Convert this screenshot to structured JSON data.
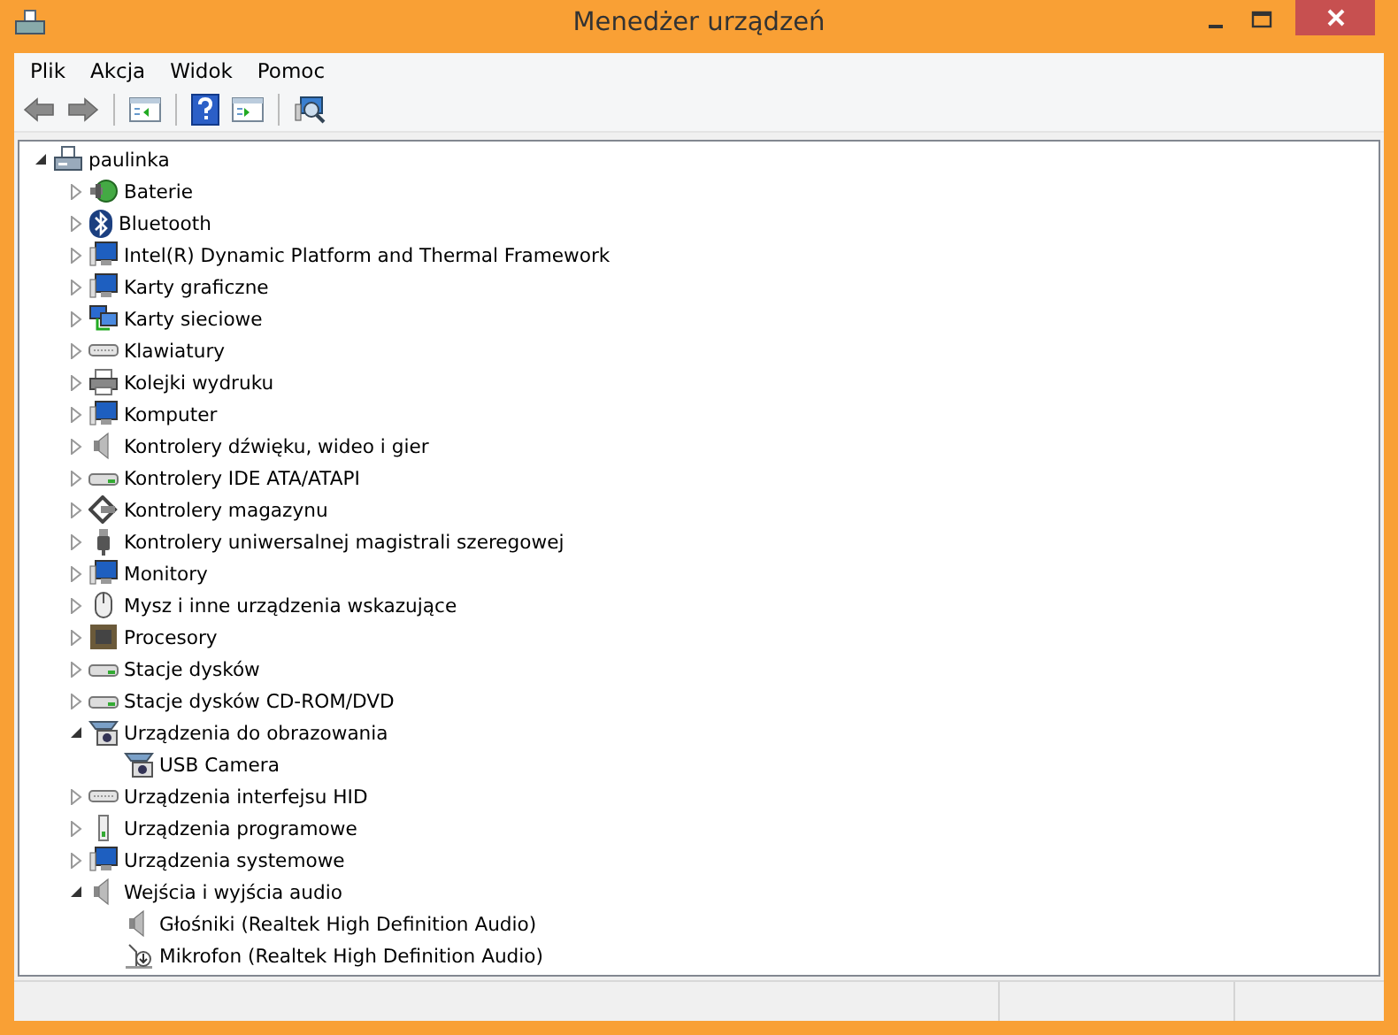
{
  "window": {
    "title": "Menedżer urządzeń"
  },
  "menu": [
    "Plik",
    "Akcja",
    "Widok",
    "Pomoc"
  ],
  "toolbar": [
    {
      "kind": "back",
      "disabled": false
    },
    {
      "kind": "forward",
      "disabled": false
    },
    {
      "kind": "separator"
    },
    {
      "kind": "panel",
      "disabled": false
    },
    {
      "kind": "separator"
    },
    {
      "kind": "help",
      "disabled": false
    },
    {
      "kind": "panel-play",
      "disabled": false
    },
    {
      "kind": "separator"
    },
    {
      "kind": "scan",
      "disabled": false
    }
  ],
  "tree": [
    {
      "label": "paulinka",
      "expanded": true,
      "children": [
        {
          "label": "Baterie",
          "expanded": false
        },
        {
          "label": "Bluetooth",
          "expanded": false
        },
        {
          "label": "Intel(R) Dynamic Platform and Thermal Framework",
          "expanded": false
        },
        {
          "label": "Karty graficzne",
          "expanded": false
        },
        {
          "label": "Karty sieciowe",
          "expanded": false
        },
        {
          "label": "Klawiatury",
          "expanded": false
        },
        {
          "label": "Kolejki wydruku",
          "expanded": false
        },
        {
          "label": "Komputer",
          "expanded": false
        },
        {
          "label": "Kontrolery dźwięku, wideo i gier",
          "expanded": false
        },
        {
          "label": "Kontrolery IDE ATA/ATAPI",
          "expanded": false
        },
        {
          "label": "Kontrolery magazynu",
          "expanded": false
        },
        {
          "label": "Kontrolery uniwersalnej magistrali szeregowej",
          "expanded": false
        },
        {
          "label": "Monitory",
          "expanded": false
        },
        {
          "label": "Mysz i inne urządzenia wskazujące",
          "expanded": false
        },
        {
          "label": "Procesory",
          "expanded": false
        },
        {
          "label": "Stacje dysków",
          "expanded": false
        },
        {
          "label": "Stacje dysków CD-ROM/DVD",
          "expanded": false
        },
        {
          "label": "Urządzenia do obrazowania",
          "expanded": true,
          "children": [
            {
              "label": "USB Camera"
            }
          ]
        },
        {
          "label": "Urządzenia interfejsu HID",
          "expanded": false
        },
        {
          "label": "Urządzenia programowe",
          "expanded": false
        },
        {
          "label": "Urządzenia systemowe",
          "expanded": false
        },
        {
          "label": "Wejścia i wyjścia audio",
          "expanded": true,
          "children": [
            {
              "label": "Głośniki (Realtek High Definition Audio)"
            },
            {
              "label": "Mikrofon (Realtek High Definition Audio)"
            }
          ]
        }
      ]
    }
  ]
}
